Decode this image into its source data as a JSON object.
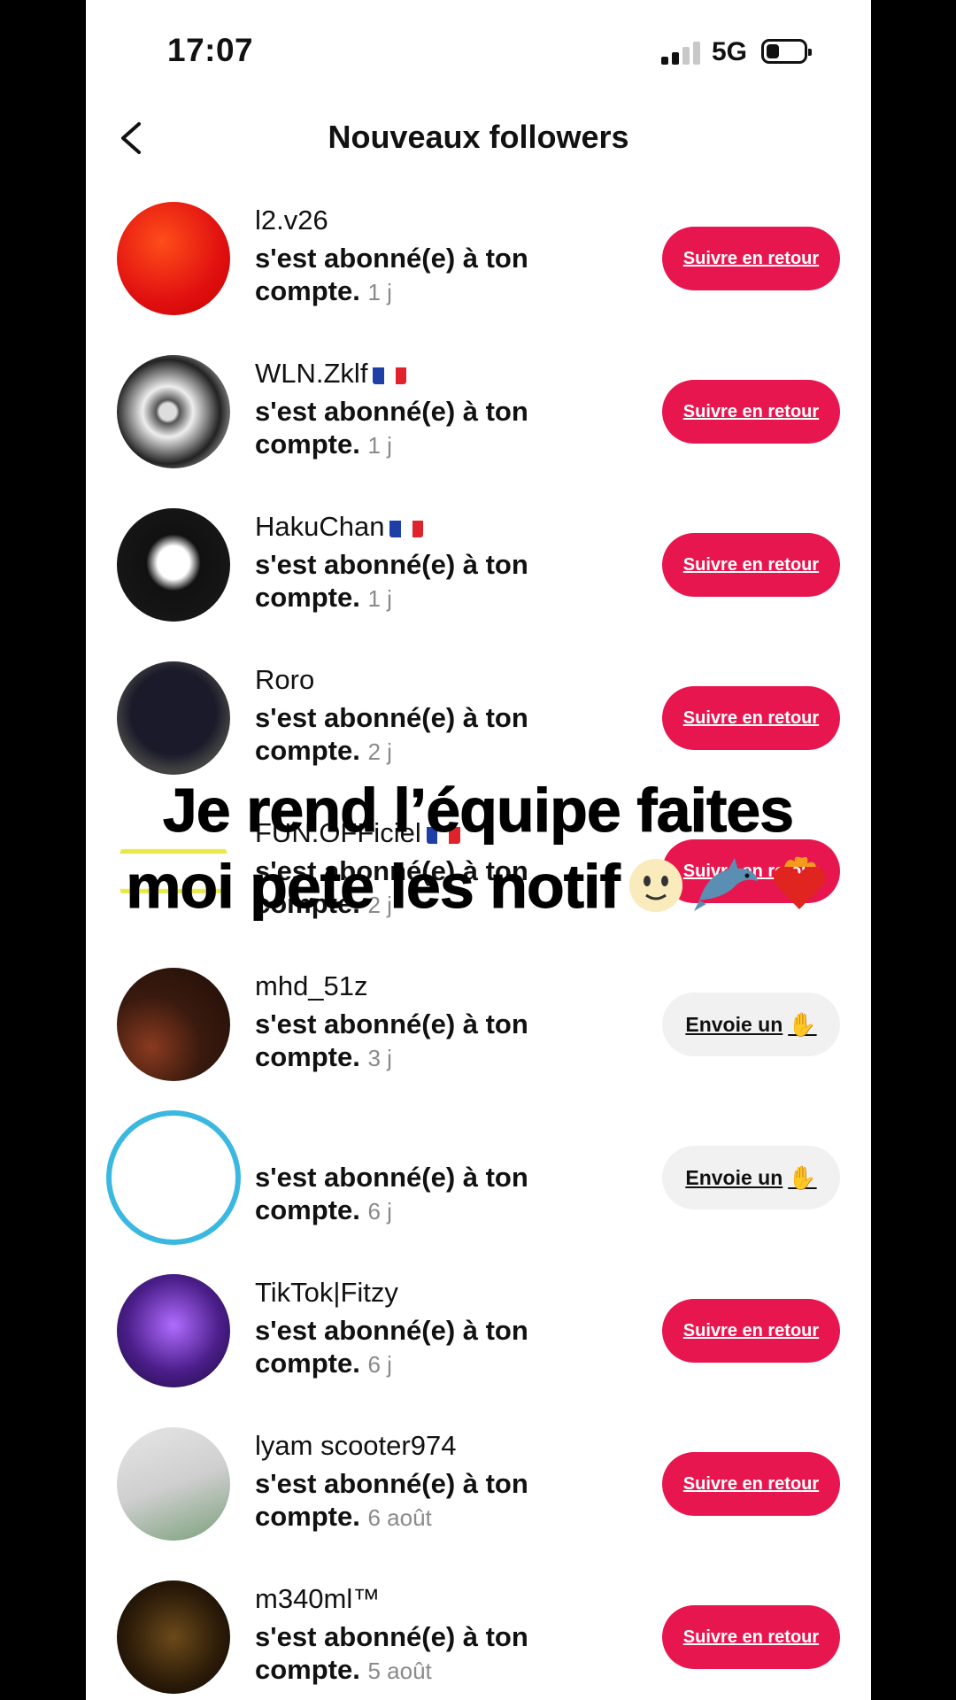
{
  "status_bar": {
    "time": "17:07",
    "network": "5G"
  },
  "header": {
    "title": "Nouveaux followers"
  },
  "rows": [
    {
      "username": "l2.v26",
      "flag": false,
      "text": "s'est abonné(e) à ton compte.",
      "ago": "1 j",
      "button": "Suivre en retour",
      "style": "follow"
    },
    {
      "username": "WLN.Zklf",
      "flag": true,
      "text": "s'est abonné(e) à ton compte.",
      "ago": "1 j",
      "button": "Suivre en retour",
      "style": "follow"
    },
    {
      "username": "HakuChan",
      "flag": true,
      "text": "s'est abonné(e) à ton compte.",
      "ago": "1 j",
      "button": "Suivre en retour",
      "style": "follow"
    },
    {
      "username": "Roro",
      "flag": false,
      "text": "s'est abonné(e) à ton compte.",
      "ago": "2 j",
      "button": "Suivre en retour",
      "style": "follow"
    },
    {
      "username": "FUN.OFFiciel",
      "flag": true,
      "text": "s'est abonné(e) à ton compte.",
      "ago": "2 j",
      "button": "Suivre en retour",
      "style": "follow"
    },
    {
      "username": "mhd_51z",
      "flag": false,
      "text": "s'est abonné(e) à ton compte.",
      "ago": "3 j",
      "button": "Envoie un",
      "style": "wave"
    },
    {
      "username": "",
      "flag": false,
      "text": "s'est abonné(e) à ton compte.",
      "ago": "6 j",
      "button": "Envoie un",
      "style": "wave"
    },
    {
      "username": "TikTok|Fitzy",
      "flag": false,
      "text": "s'est abonné(e) à ton compte.",
      "ago": "6 j",
      "button": "Suivre en retour",
      "style": "follow"
    },
    {
      "username": "lyam scooter974",
      "flag": false,
      "text": "s'est abonné(e) à ton compte.",
      "ago": "6 août",
      "button": "Suivre en retour",
      "style": "follow"
    },
    {
      "username": "m340ml™",
      "flag": false,
      "text": "s'est abonné(e) à ton compte.",
      "ago": "5 août",
      "button": "Suivre en retour",
      "style": "follow"
    }
  ],
  "overlay": {
    "line1": "Je rend l’équipe faites",
    "line2": "moi pete les notif"
  },
  "colors": {
    "follow_button": "#e8164e",
    "wave_button": "#f1f1f2"
  }
}
